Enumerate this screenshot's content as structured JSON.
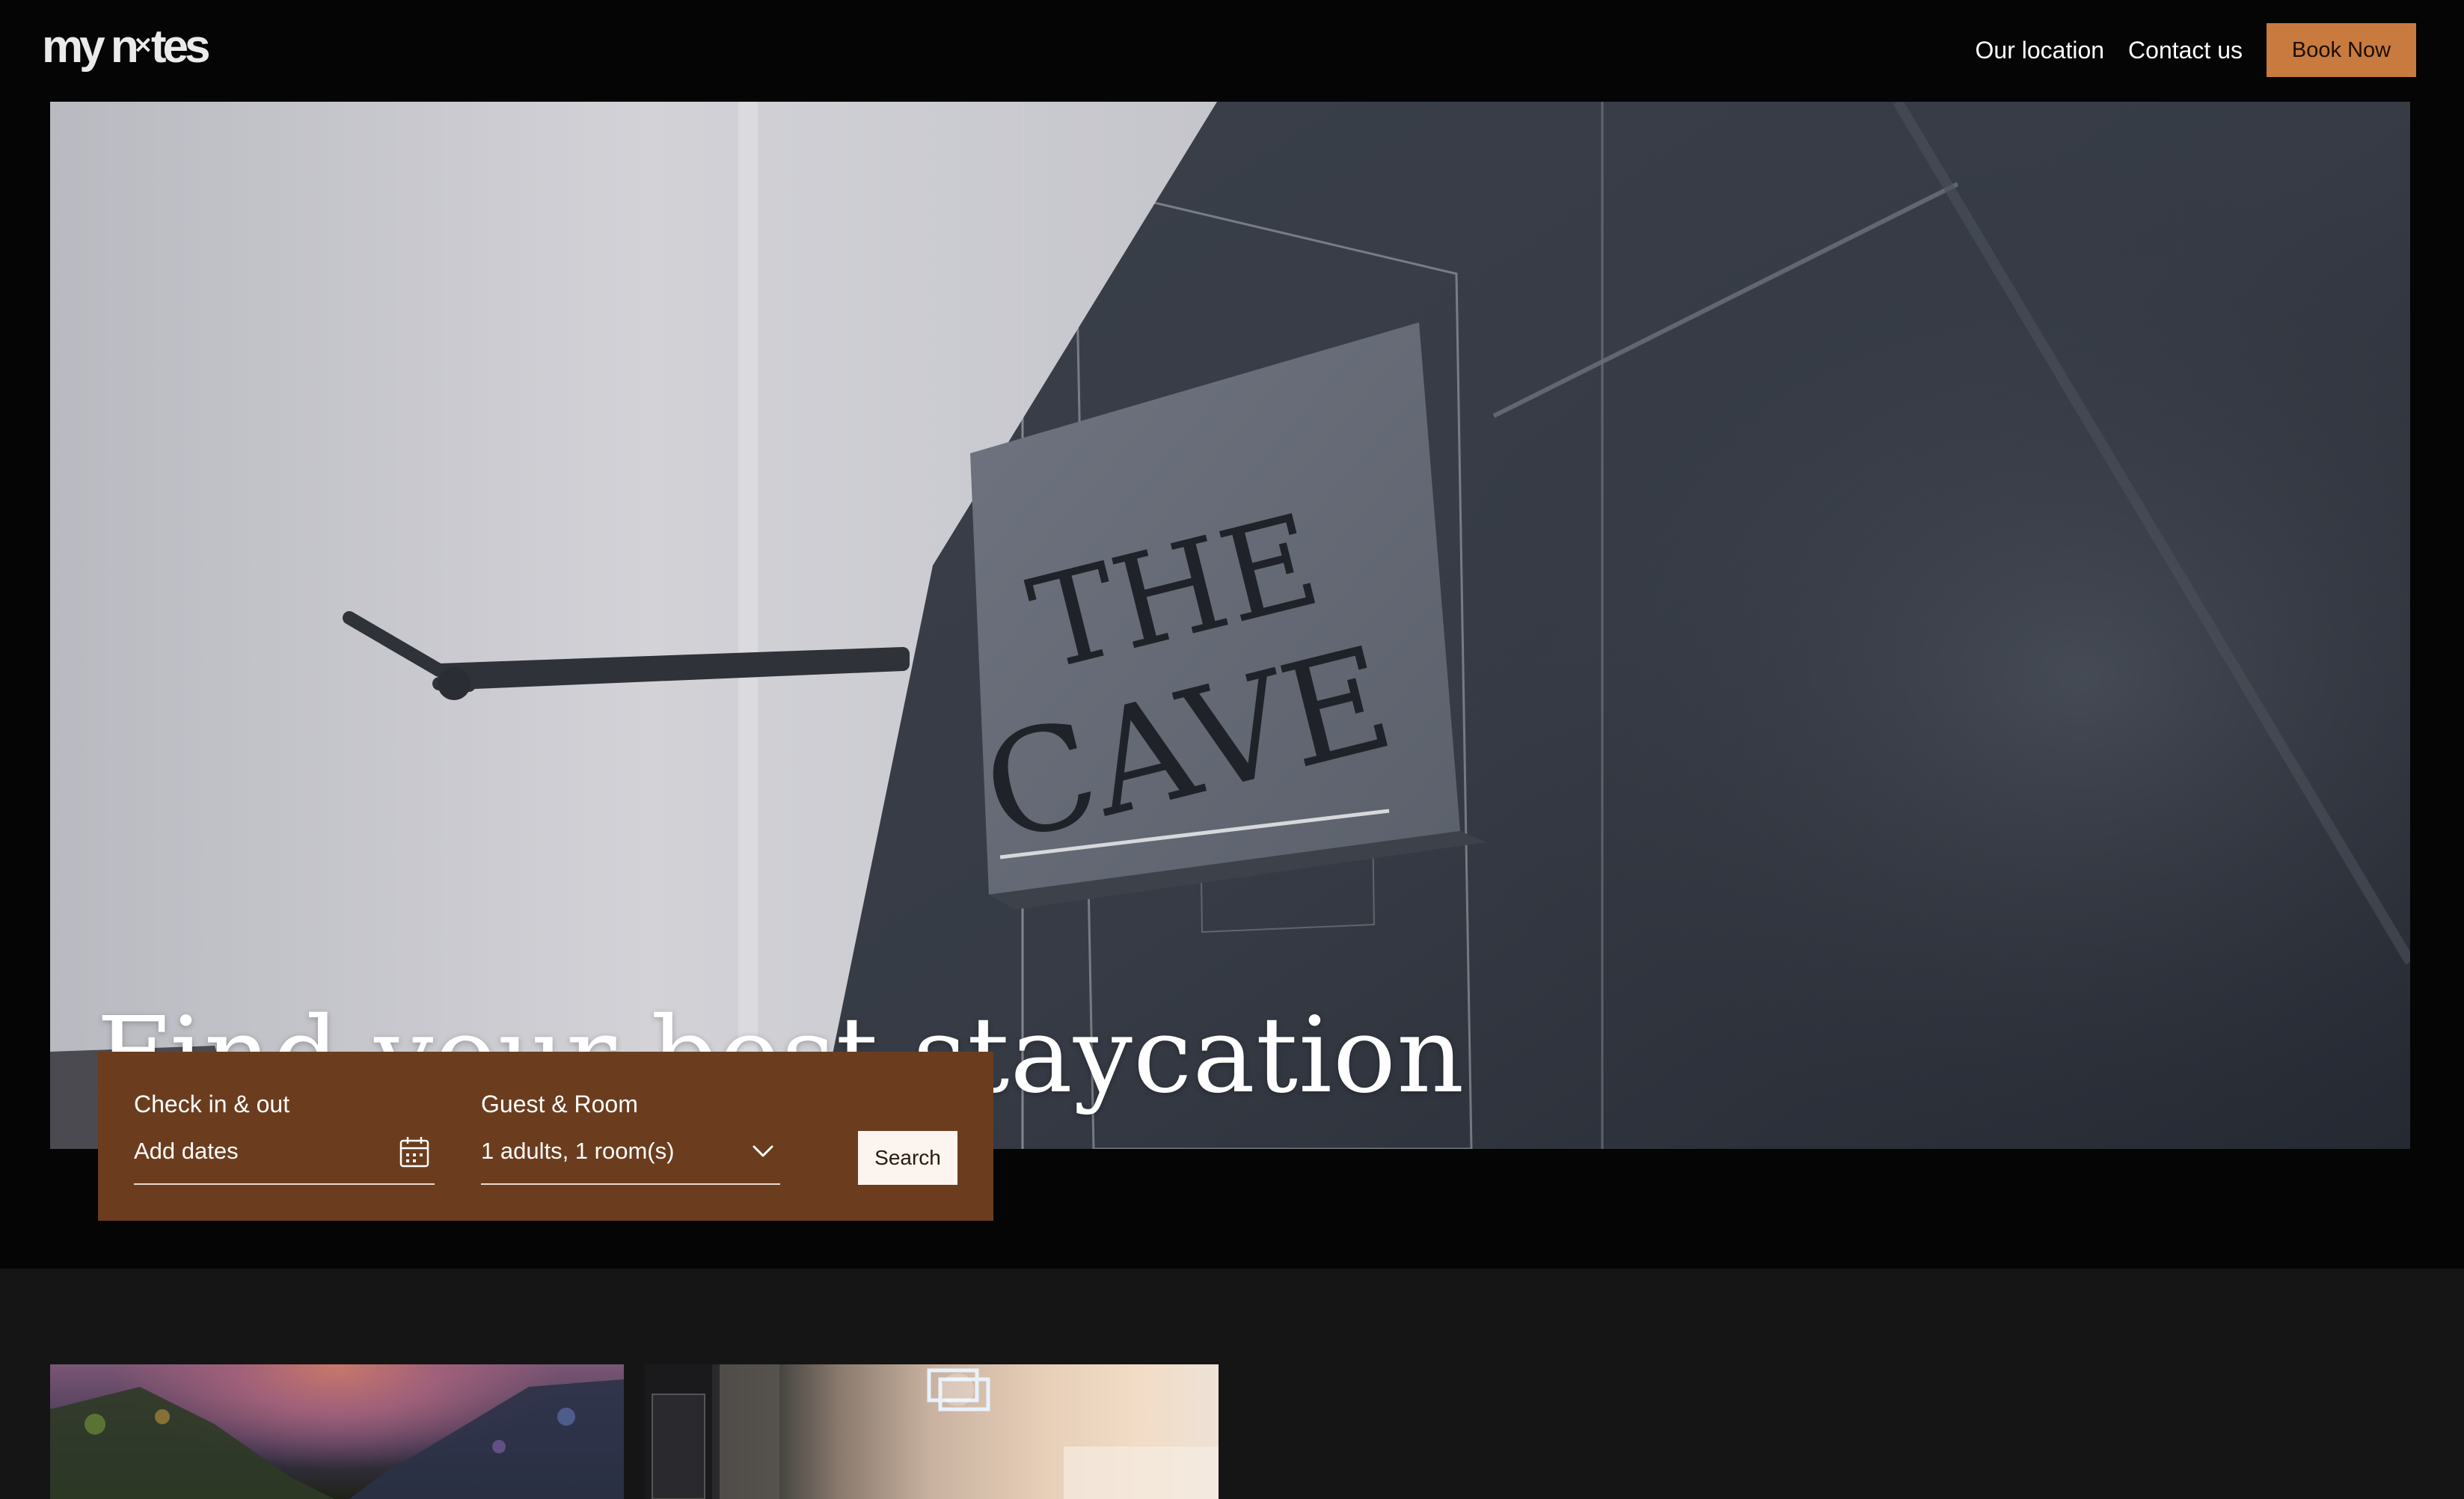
{
  "brand": {
    "logo_text_left": "my n",
    "logo_mark": "✕",
    "logo_text_right": "tes",
    "logo_name": "my nites"
  },
  "nav": {
    "links": [
      "Our location",
      "Contact us"
    ],
    "cta_label": "Book Now",
    "cta_color": "#c97a3e"
  },
  "hero": {
    "title": "Find your best staycation",
    "sign_line1": "THE",
    "sign_line2": "CAVE"
  },
  "search": {
    "panel_color": "#6b3d1e",
    "dates": {
      "label": "Check in & out",
      "placeholder": "Add dates",
      "icon": "calendar-icon"
    },
    "guests": {
      "label": "Guest & Room",
      "value": "1 adults, 1 room(s)",
      "icon": "chevron-down-icon"
    },
    "button_label": "Search"
  },
  "cards": [
    {
      "name": "card-location-garden"
    },
    {
      "name": "card-location-room"
    }
  ]
}
